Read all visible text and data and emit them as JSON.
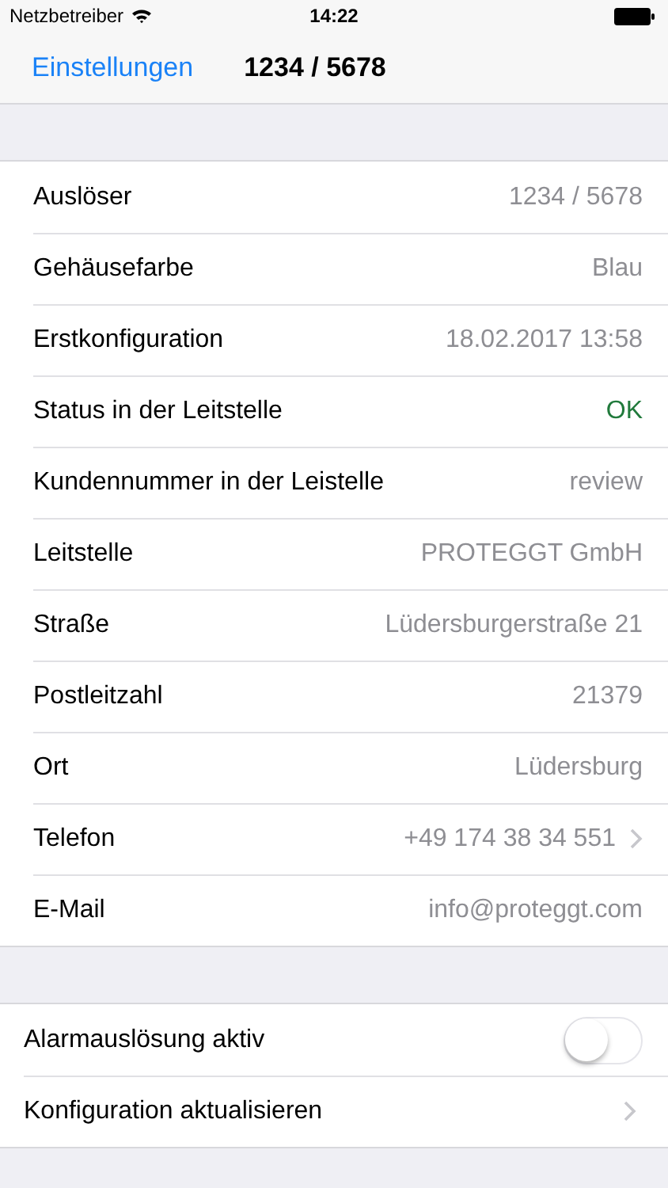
{
  "status_bar": {
    "carrier": "Netzbetreiber",
    "time": "14:22"
  },
  "nav": {
    "back": "Einstellungen",
    "title": "1234 / 5678"
  },
  "details": [
    {
      "kind": "plain",
      "label": "Auslöser",
      "value": "1234 / 5678"
    },
    {
      "kind": "plain",
      "label": "Gehäusefarbe",
      "value": "Blau"
    },
    {
      "kind": "plain",
      "label": "Erstkonfiguration",
      "value": "18.02.2017 13:58"
    },
    {
      "kind": "plain",
      "label": "Status in der Leitstelle",
      "value": "OK",
      "color": "#217a3c"
    },
    {
      "kind": "plain",
      "label": "Kundennummer in der Leistelle",
      "value": "review"
    },
    {
      "kind": "plain",
      "label": "Leitstelle",
      "value": "PROTEGGT GmbH"
    },
    {
      "kind": "plain",
      "label": "Straße",
      "value": "Lüdersburgerstraße 21"
    },
    {
      "kind": "plain",
      "label": "Postleitzahl",
      "value": "21379"
    },
    {
      "kind": "plain",
      "label": "Ort",
      "value": "Lüdersburg"
    },
    {
      "kind": "link",
      "label": "Telefon",
      "value": "+49 174 38 34 551"
    },
    {
      "kind": "plain",
      "label": "E-Mail",
      "value": "info@proteggt.com"
    }
  ],
  "actions": [
    {
      "kind": "toggle",
      "label": "Alarmauslösung aktiv",
      "on": false
    },
    {
      "kind": "link",
      "label": "Konfiguration aktualisieren"
    }
  ]
}
